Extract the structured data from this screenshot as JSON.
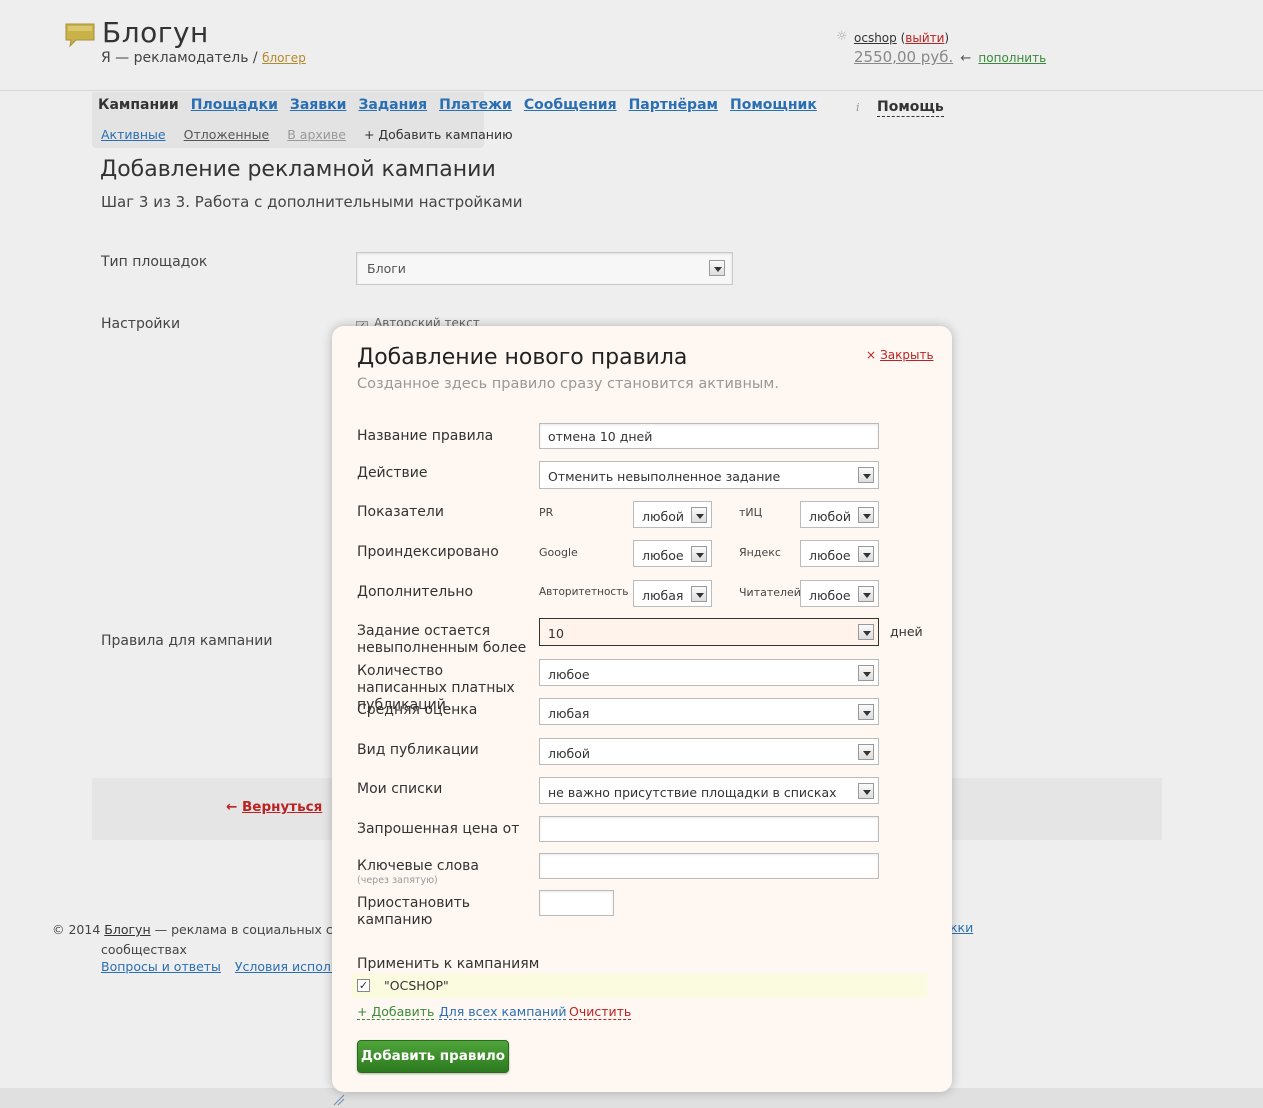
{
  "app": {
    "name": "Блогун",
    "role_prefix": "Я — рекламодатель /",
    "role_switch": "блогер",
    "brand_color": "#c9b24a"
  },
  "user": {
    "name": "ocshop",
    "logout_open": "(",
    "logout": "выйти",
    "logout_close": ")",
    "balance": "2550,00 руб.",
    "topup_arrow": "←",
    "topup": "пополнить"
  },
  "nav": {
    "tabs": [
      "Кампании",
      "Площадки",
      "Заявки",
      "Задания",
      "Платежи",
      "Сообщения",
      "Партнёрам",
      "Помощник"
    ],
    "subtabs": [
      "Активные",
      "Отложенные",
      "В архиве",
      "+ Добавить кампанию"
    ],
    "help_icon": "i",
    "help": "Помощь"
  },
  "page": {
    "title": "Добавление рекламной кампании",
    "step": "Шаг 3 из 3. Работа с дополнительными настройками",
    "type_label": "Тип площадок",
    "type_value": "Блоги",
    "settings_label": "Настройки",
    "settings_option": "Авторский текст",
    "rules_label": "Правила для кампании",
    "back_arrow": "←",
    "back": "Вернуться"
  },
  "footer": {
    "copyright": "© 2014",
    "brand": "Блогун",
    "tagline": "— реклама в социальных сетя",
    "tagline_2": "сообществах",
    "links": [
      "Вопросы и ответы",
      "Условия использо"
    ],
    "right_link": "кки"
  },
  "modal": {
    "title": "Добавление нового правила",
    "subtitle": "Созданное здесь правило сразу становится активным.",
    "close_x": "×",
    "close": "Закрыть",
    "rule_name_label": "Название правила",
    "rule_name_value": "отмена 10 дней",
    "action_label": "Действие",
    "action_value": "Отменить невыполненное задание",
    "metrics_label": "Показатели",
    "pr_label": "PR",
    "pr_value": "любой",
    "tic_label": "тИЦ",
    "tic_value": "любой",
    "indexed_label": "Проиндексировано",
    "google_label": "Google",
    "google_value": "любое",
    "yandex_label": "Яндекс",
    "yandex_value": "любое",
    "extra_label": "Дополнительно",
    "authority_label": "Авторитетность",
    "authority_value": "любая",
    "readers_label": "Читателей",
    "readers_value": "любое",
    "pending_label": "Задание остается невыполненным более",
    "pending_value": "10",
    "pending_unit": "дней",
    "paid_count_label": "Количество написанных платных публикаций",
    "paid_count_value": "любое",
    "rating_label": "Средняя оценка",
    "rating_value": "любая",
    "pub_type_label": "Вид публикации",
    "pub_type_value": "любой",
    "lists_label": "Мои списки",
    "lists_value": "не важно присутствие площадки в списках",
    "price_label": "Запрошенная цена от",
    "price_value": "",
    "keywords_label": "Ключевые слова",
    "keywords_hint": "(через запятую)",
    "keywords_value": "",
    "pause_label": "Приостановить кампанию",
    "pause_value": "",
    "apply_label": "Применить к кампаниям",
    "campaign_checked": "✓",
    "campaign_name": "\"OCSHOP\"",
    "add": "+ Добавить",
    "all_campaigns": "Для всех кампаний",
    "clear": "Очистить",
    "submit": "Добавить правило"
  }
}
